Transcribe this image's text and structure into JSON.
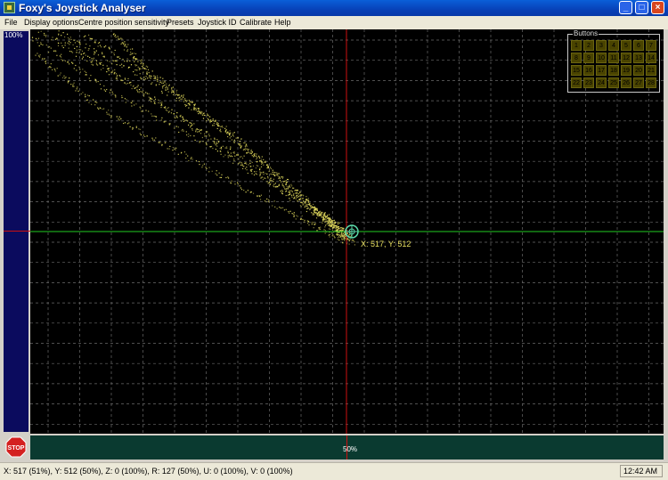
{
  "window": {
    "title": "Foxy's Joystick Analyser",
    "controls": {
      "minimize": "_",
      "maximize": "□",
      "close": "×"
    }
  },
  "menu": [
    "File",
    "Display options",
    "Centre position sensitivity",
    "Presets",
    "Joystick ID",
    "Calibrate",
    "Help"
  ],
  "y_axis_label": "100%",
  "x_axis_label": "50%",
  "crosshair_readout": "X: 517, Y: 512",
  "buttons_panel": {
    "label": "Buttons",
    "buttons": [
      "1",
      "2",
      "3",
      "4",
      "5",
      "6",
      "7",
      "8",
      "9",
      "10",
      "11",
      "12",
      "13",
      "14",
      "15",
      "16",
      "17",
      "18",
      "19",
      "20",
      "21",
      "22",
      "23",
      "24",
      "25",
      "26",
      "27",
      "28"
    ]
  },
  "stop_button_label": "STOP",
  "status": {
    "axes": "X: 517 (51%), Y: 512 (50%), Z: 0 (100%), R: 127 (50%), U: 0 (100%), V: 0 (100%)",
    "time": "12:42 AM"
  },
  "colors": {
    "plot_background": "#000000",
    "grid": "#6a6a6a",
    "trace": "#e8e060",
    "crosshair_horizontal": "#22cc22",
    "crosshair_vertical": "#cc1010",
    "y_track": "#0b0b5e",
    "x_track": "#0a3a30",
    "button_cell": "#4a4400"
  }
}
